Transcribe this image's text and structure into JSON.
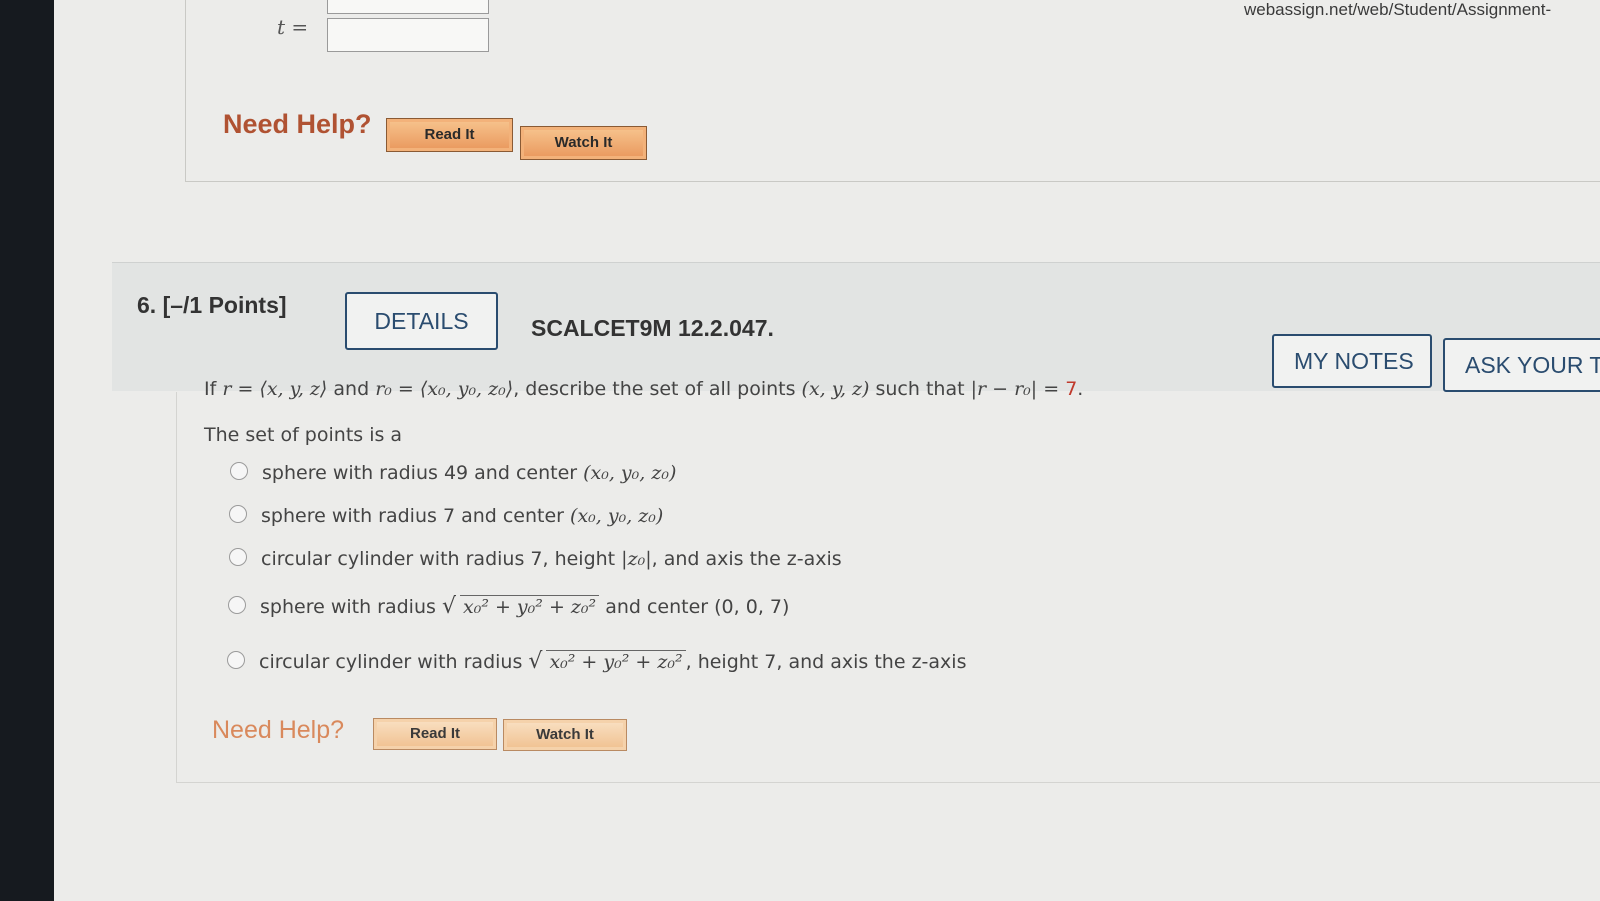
{
  "browser": {
    "url": "webassign.net/web/Student/Assignment-"
  },
  "prev_question": {
    "t_label": "t =",
    "need_help": "Need Help?",
    "read_it": "Read It",
    "watch_it": "Watch It"
  },
  "question": {
    "number": "6.  [–/1 Points]",
    "details_button": "DETAILS",
    "code": "SCALCET9M 12.2.047.",
    "my_notes_button": "MY NOTES",
    "ask_teacher_button": "ASK YOUR TE",
    "prompt": {
      "prefix": "If ",
      "r_def": "r = ⟨x, y, z⟩",
      "and": " and ",
      "r0_def": "r₀ = ⟨x₀, y₀, z₀⟩",
      "middle": ", describe the set of all points ",
      "point": "(x, y, z)",
      "such_that": " such that ",
      "condition_lhs": "|r − r₀| = ",
      "condition_rhs": "7",
      "end": "."
    },
    "lead_in": "The set of points is a",
    "options": [
      {
        "text": "sphere with radius 49 and center ",
        "math": "(x₀, y₀, z₀)"
      },
      {
        "text": "sphere with radius 7 and center ",
        "math": "(x₀, y₀, z₀)"
      },
      {
        "text": "circular cylinder with radius 7, height ",
        "math": "|z₀|",
        "suffix": ", and axis the z-axis"
      },
      {
        "text": "sphere with radius ",
        "math": "x₀² + y₀² + z₀²",
        "suffix": " and center (0, 0, 7)"
      },
      {
        "text": "circular cylinder with radius ",
        "math": "x₀² + y₀² + z₀²",
        "suffix": ", height 7, and axis the z-axis"
      }
    ],
    "need_help": "Need Help?",
    "read_it": "Read It",
    "watch_it": "Watch It"
  },
  "colors": {
    "accent": "#2a4c6f",
    "help_text": "#b05232",
    "correct_value": "#c0392b"
  }
}
